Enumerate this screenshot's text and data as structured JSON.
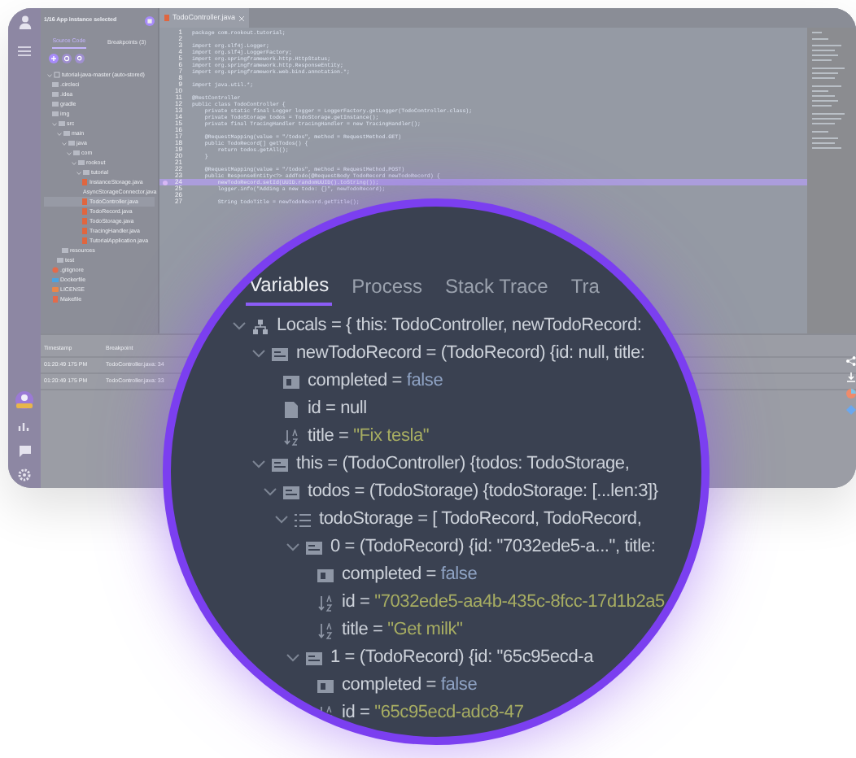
{
  "sidebar": {
    "header": "1/16 App instance selected",
    "tabs": [
      {
        "label": "Source Code",
        "selected": true
      },
      {
        "label": "Breakpoints (3)",
        "selected": false
      }
    ],
    "tree": [
      {
        "label": "tutorial-java-master (auto-stored)",
        "kind": "repo",
        "expanded": true,
        "children": [
          {
            "label": ".circleci",
            "kind": "folder"
          },
          {
            "label": ".idea",
            "kind": "folder"
          },
          {
            "label": "gradle",
            "kind": "folder"
          },
          {
            "label": "img",
            "kind": "folder"
          },
          {
            "label": "src",
            "kind": "folder",
            "expanded": true,
            "children": [
              {
                "label": "main",
                "kind": "folder",
                "expanded": true,
                "children": [
                  {
                    "label": "java",
                    "kind": "folder",
                    "expanded": true,
                    "children": [
                      {
                        "label": "com",
                        "kind": "folder",
                        "expanded": true,
                        "children": [
                          {
                            "label": "rookout",
                            "kind": "folder",
                            "expanded": true,
                            "children": [
                              {
                                "label": "tutorial",
                                "kind": "folder",
                                "expanded": true,
                                "children": [
                                  {
                                    "label": "InstanceStorage.java",
                                    "kind": "java",
                                    "selected": false
                                  },
                                  {
                                    "label": "AsyncStorageConnector.java",
                                    "kind": "java",
                                    "selected": false
                                  },
                                  {
                                    "label": "TodoController.java",
                                    "kind": "java",
                                    "selected": true
                                  },
                                  {
                                    "label": "TodoRecord.java",
                                    "kind": "java",
                                    "selected": false
                                  },
                                  {
                                    "label": "TodoStorage.java",
                                    "kind": "java",
                                    "selected": false
                                  },
                                  {
                                    "label": "TracingHandler.java",
                                    "kind": "java",
                                    "selected": false
                                  },
                                  {
                                    "label": "TutorialApplication.java",
                                    "kind": "java",
                                    "selected": false
                                  }
                                ]
                              }
                            ]
                          }
                        ]
                      }
                    ]
                  },
                  {
                    "label": "resources",
                    "kind": "folder"
                  }
                ]
              },
              {
                "label": "test",
                "kind": "folder"
              }
            ]
          },
          {
            "label": ".gitignore",
            "kind": "git"
          },
          {
            "label": "Dockerfile",
            "kind": "docker"
          },
          {
            "label": "LICENSE",
            "kind": "license"
          },
          {
            "label": "Makefile",
            "kind": "file"
          }
        ]
      }
    ]
  },
  "editor": {
    "tab": "TodoController.java",
    "lines": [
      {
        "n": "1",
        "code": "package com.rookout.tutorial;",
        "breakpoint": false,
        "highlighted": false
      },
      {
        "n": "2",
        "breakpoint": false,
        "highlighted": false
      },
      {
        "n": "3",
        "code": "import org.slf4j.Logger;",
        "breakpoint": false,
        "highlighted": false
      },
      {
        "n": "4",
        "code": "import org.slf4j.LoggerFactory;",
        "breakpoint": false,
        "highlighted": false
      },
      {
        "n": "5",
        "code": "import org.springframework.http.HttpStatus;",
        "breakpoint": false,
        "highlighted": false
      },
      {
        "n": "6",
        "code": "import org.springframework.http.ResponseEntity;",
        "breakpoint": false,
        "highlighted": false
      },
      {
        "n": "7",
        "code": "import org.springframework.web.bind.annotation.*;",
        "breakpoint": false,
        "highlighted": false
      },
      {
        "n": "8",
        "breakpoint": false,
        "highlighted": false
      },
      {
        "n": "9",
        "code": "import java.util.*;",
        "breakpoint": false,
        "highlighted": false
      },
      {
        "n": "10",
        "breakpoint": false,
        "highlighted": false
      },
      {
        "n": "11",
        "code": "@RestController",
        "breakpoint": false,
        "highlighted": false
      },
      {
        "n": "12",
        "code": "public class TodoController {",
        "breakpoint": false,
        "highlighted": false
      },
      {
        "n": "13",
        "code": "    private static final Logger logger = LoggerFactory.getLogger(TodoController.class);",
        "breakpoint": false,
        "highlighted": false
      },
      {
        "n": "14",
        "code": "    private TodoStorage todos = TodoStorage.getInstance();",
        "breakpoint": false,
        "highlighted": false
      },
      {
        "n": "15",
        "code": "    private final TracingHandler tracingHandler = new TracingHandler();",
        "breakpoint": false,
        "highlighted": false
      },
      {
        "n": "16",
        "breakpoint": false,
        "highlighted": false
      },
      {
        "n": "17",
        "code": "    @RequestMapping(value = \"/todos\", method = RequestMethod.GET)",
        "breakpoint": false,
        "highlighted": false
      },
      {
        "n": "18",
        "code": "    public TodoRecord[] getTodos() {",
        "breakpoint": false,
        "highlighted": false
      },
      {
        "n": "19",
        "code": "        return todos.getAll();",
        "breakpoint": false,
        "highlighted": false
      },
      {
        "n": "20",
        "code": "    }",
        "breakpoint": false,
        "highlighted": false
      },
      {
        "n": "21",
        "breakpoint": false,
        "highlighted": false
      },
      {
        "n": "22",
        "code": "    @RequestMapping(value = \"/todos\", method = RequestMethod.POST)",
        "breakpoint": false,
        "highlighted": false
      },
      {
        "n": "23",
        "code": "    public ResponseEntity<?> addTodo(@RequestBody TodoRecord newTodoRecord) {",
        "breakpoint": false,
        "highlighted": false
      },
      {
        "n": "24",
        "code": "        newTodoRecord.setId(UUID.randomUUID().toString());",
        "breakpoint": true,
        "highlighted": true
      },
      {
        "n": "25",
        "code": "        logger.info(\"Adding a new todo: {}\", newTodoRecord);",
        "breakpoint": false,
        "highlighted": false
      },
      {
        "n": "26",
        "breakpoint": false,
        "highlighted": false
      },
      {
        "n": "27",
        "code": "        String todoTitle = newTodoRecord.getTitle();",
        "breakpoint": false,
        "highlighted": false
      }
    ]
  },
  "debugger": {
    "tabs": [
      {
        "label": "Variables",
        "selected": true
      },
      {
        "label": "Process",
        "selected": false
      },
      {
        "label": "Stack Trace",
        "selected": false
      },
      {
        "label": "Tra",
        "selected": false
      }
    ],
    "variables": [
      {
        "label": "Locals = { this: TodoController, newTodoRecord:",
        "kind": "scope",
        "expanded": true,
        "children": [
          {
            "label": "newTodoRecord = (TodoRecord) {id: null, title:",
            "kind": "object",
            "expanded": true,
            "children": [
              {
                "label": "completed = ",
                "value": "false",
                "kind": "boolean"
              },
              {
                "label": "id = null",
                "kind": "null"
              },
              {
                "label": "title = ",
                "value": "\"Fix tesla\"",
                "kind": "string"
              }
            ]
          },
          {
            "label": "this = (TodoController) {todos: TodoStorage,",
            "kind": "object",
            "expanded": true,
            "children": [
              {
                "label": "todos = (TodoStorage) {todoStorage: [...len:3]}",
                "kind": "object",
                "expanded": true,
                "children": [
                  {
                    "label": "todoStorage = [ TodoRecord, TodoRecord,",
                    "kind": "array",
                    "expanded": true,
                    "children": [
                      {
                        "label": "0 = (TodoRecord) {id: \"7032ede5-a...\", title:",
                        "kind": "object",
                        "expanded": true,
                        "children": [
                          {
                            "label": "completed = ",
                            "value": "false",
                            "kind": "boolean"
                          },
                          {
                            "label": "id = ",
                            "value": "\"7032ede5-aa4b-435c-8fcc-17d1b2a5",
                            "kind": "string"
                          },
                          {
                            "label": "title = ",
                            "value": "\"Get milk\"",
                            "kind": "string"
                          }
                        ]
                      },
                      {
                        "label": "1 = (TodoRecord) {id: \"65c95ecd-a",
                        "kind": "object",
                        "expanded": true,
                        "children": [
                          {
                            "label": "completed = ",
                            "value": "false",
                            "kind": "boolean"
                          },
                          {
                            "label": "id = ",
                            "value": "\"65c95ecd-adc8-47",
                            "kind": "string"
                          }
                        ]
                      }
                    ]
                  }
                ]
              }
            ]
          }
        ]
      }
    ]
  },
  "breakpoints_panel": {
    "columns": [
      "Timestamp",
      "Breakpoint"
    ],
    "rows": [
      [
        "01:20:49 175 PM",
        "TodoController.java: 34"
      ],
      [
        "01:20:49 175 PM",
        "TodoController.java: 33"
      ]
    ]
  }
}
